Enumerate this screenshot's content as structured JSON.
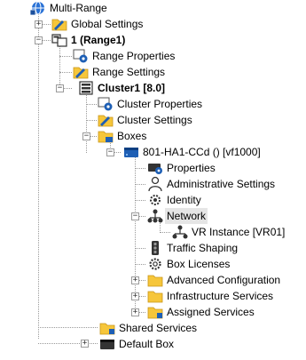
{
  "tree": {
    "root": "Multi-Range",
    "global_settings": "Global Settings",
    "range": "1 (Range1)",
    "range_properties": "Range Properties",
    "range_settings": "Range Settings",
    "cluster": "Cluster1 [8.0]",
    "cluster_properties": "Cluster Properties",
    "cluster_settings": "Cluster Settings",
    "boxes": "Boxes",
    "box": "801-HA1-CCd () [vf1000]",
    "properties": "Properties",
    "administrative_settings": "Administrative Settings",
    "identity": "Identity",
    "network": "Network",
    "vr_instance": "VR Instance [VR01]",
    "traffic_shaping": "Traffic Shaping",
    "box_licenses": "Box Licenses",
    "advanced_configuration": "Advanced Configuration",
    "infrastructure_services": "Infrastructure Services",
    "assigned_services": "Assigned Services",
    "shared_services": "Shared Services",
    "default_box": "Default Box"
  },
  "expanders": {
    "expanded": "−",
    "collapsed": "+"
  },
  "icons": {
    "multi_range": "network-globe-icon",
    "folder": "folder-icon",
    "range": "range-boxes-icon",
    "gear": "gear-icon",
    "cluster": "server-cluster-icon",
    "box": "box-device-icon",
    "admin": "person-icon",
    "identity": "identity-gear-icon",
    "network": "network-tree-icon",
    "traffic": "traffic-light-icon",
    "license": "license-gear-icon"
  },
  "colors": {
    "folder": "#f6c63a",
    "accent_blue": "#1e5fb5",
    "selection": "#e5e5e5"
  }
}
